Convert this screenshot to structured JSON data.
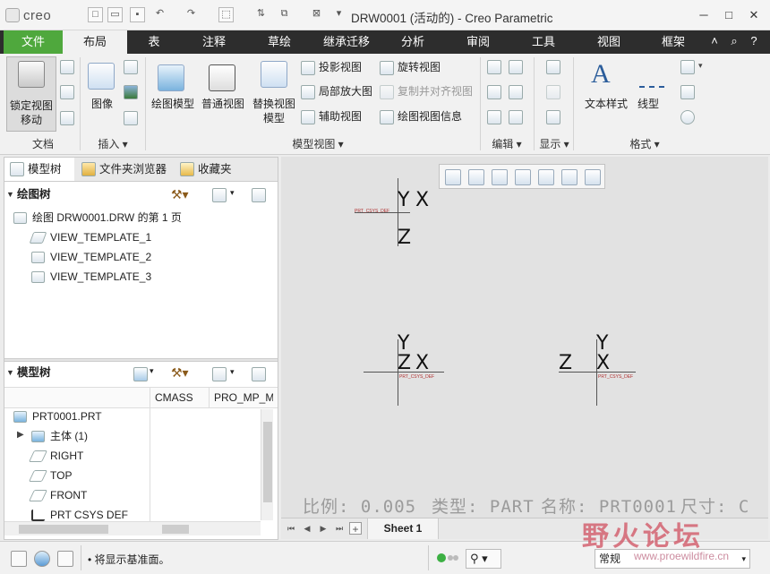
{
  "app": {
    "logo": "creo",
    "title": "DRW0001 (活动的) - Creo Parametric",
    "quick_access": [
      "new-icon",
      "open-icon",
      "save-icon",
      "undo-icon",
      "redo-icon",
      "select-box-icon",
      "regenerate-icon",
      "window-icon",
      "close-window-icon"
    ]
  },
  "tabs": [
    "文件",
    "布局",
    "表",
    "注释",
    "草绘",
    "继承迁移",
    "分析",
    "审阅",
    "工具",
    "视图",
    "框架"
  ],
  "ribbon": {
    "doc": {
      "btn": "锁定视图\n移动",
      "label": "文档"
    },
    "insert": {
      "btn": "图像",
      "label": "插入"
    },
    "model_views": {
      "label": "模型视图",
      "big": [
        "绘图模型",
        "普通视图",
        "替换视图\n模型"
      ],
      "col1": [
        "投影视图",
        "局部放大图",
        "辅助视图"
      ],
      "col2": [
        "旋转视图",
        "复制并对齐视图",
        "绘图视图信息"
      ]
    },
    "edit": {
      "label": "编辑"
    },
    "display": {
      "label": "显示"
    },
    "format": {
      "label": "格式",
      "btn1": "文本样式",
      "btn2": "线型"
    }
  },
  "panel": {
    "tabs": [
      "模型树",
      "文件夹浏览器",
      "收藏夹"
    ],
    "drawing_tree": {
      "header": "绘图树",
      "items": [
        "绘图 DRW0001.DRW 的第 1 页",
        "VIEW_TEMPLATE_1",
        "VIEW_TEMPLATE_2",
        "VIEW_TEMPLATE_3"
      ]
    },
    "model_tree": {
      "header": "模型树",
      "columns": [
        "CMASS",
        "PRO_MP_M"
      ],
      "items": [
        "PRT0001.PRT",
        "主体 (1)",
        "RIGHT",
        "TOP",
        "FRONT",
        "PRT CSYS DEF"
      ]
    }
  },
  "canvas": {
    "csys_label": "PRT_CSYS_DEF",
    "axes": {
      "x": "X",
      "y": "Y",
      "z": "Z"
    },
    "info": {
      "scale": "比例: 0.005",
      "type": "类型: PART",
      "name": "名称: PRT0001",
      "size": "尺寸: C"
    }
  },
  "sheet": {
    "tab": "Sheet 1"
  },
  "status": {
    "message": "• 将显示基准面。",
    "filter": "常规"
  },
  "watermark": {
    "text": "野火论坛",
    "url": "www.proewildfire.cn"
  }
}
